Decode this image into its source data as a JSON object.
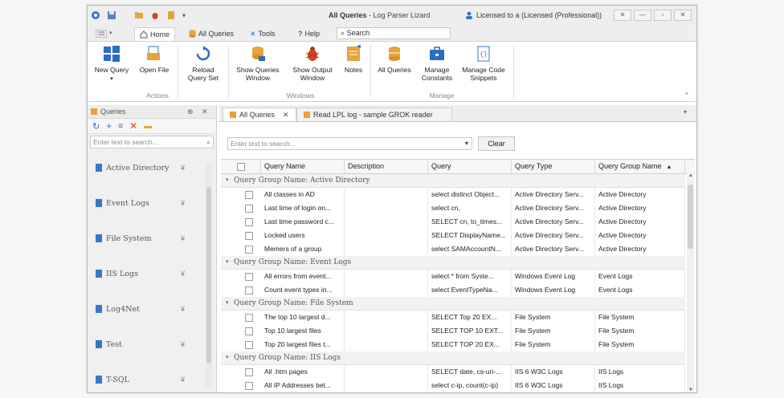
{
  "window": {
    "title_bold": "All Queries",
    "title_rest": " - Log Parser Lizard",
    "license": "Licensed to a (Licensed (Professional))"
  },
  "ribbon_tabs": {
    "home": "Home",
    "all_queries": "All Queries",
    "tools": "Tools",
    "help": "Help",
    "search": "Search"
  },
  "ribbon": {
    "new_query": "New Query",
    "open_file": "Open File",
    "reload": "Reload",
    "query_set": "Query Set",
    "show_queries": "Show Queries",
    "show_output": "Show Output",
    "window_word": "Window",
    "notes": "Notes",
    "all_queries": "All Queries",
    "manage": "Manage",
    "constants": "Constants",
    "manage_code": "Manage Code",
    "snippets": "Snippets",
    "group_actions": "Actions",
    "group_windows": "Windows",
    "group_manage": "Manage"
  },
  "left_panel": {
    "title": "Queries",
    "search_placeholder": "Enter text to search...",
    "groups": [
      "Active Directory",
      "Event Logs",
      "File System",
      "IIS Logs",
      "Log4Net",
      "Test",
      "T-SQL"
    ]
  },
  "doc_tabs": {
    "tab1": "All Queries",
    "tab2": "Read LPL log - sample GROK reader"
  },
  "filter": {
    "placeholder": "Enter text to search...",
    "clear": "Clear"
  },
  "grid": {
    "columns": [
      "Query Name",
      "Description",
      "Query",
      "Query Type",
      "Query Group Name"
    ],
    "group_prefix": "Query Group Name: ",
    "groups": [
      {
        "name": "Active Directory",
        "rows": [
          [
            "All classes in AD",
            "",
            "select distinct Object...",
            "Active Directory Serv...",
            "Active Directory"
          ],
          [
            "Last time of login on...",
            "",
            "select cn,",
            "Active Directory Serv...",
            "Active Directory"
          ],
          [
            "Last time password c...",
            "",
            "SELECT cn, to_times...",
            "Active Directory Serv...",
            "Active Directory"
          ],
          [
            "Locked users",
            "",
            "SELECT DisplayName...",
            "Active Directory Serv...",
            "Active Directory"
          ],
          [
            "Memers of a group",
            "",
            "select SAMAccountN...",
            "Active Directory Serv...",
            "Active Directory"
          ]
        ]
      },
      {
        "name": "Event Logs",
        "rows": [
          [
            "All errors from event...",
            "",
            "select * from Syste...",
            "Windows Event Log",
            "Event Logs"
          ],
          [
            "Count event types in...",
            "",
            "select EventTypeNa...",
            "Windows Event Log",
            "Event Logs"
          ]
        ]
      },
      {
        "name": "File System",
        "rows": [
          [
            "The top 10 largest d...",
            "",
            "SELECT Top 20   EX...",
            "File System",
            "File System"
          ],
          [
            "Top 10 largest files",
            "",
            "SELECT TOP 10 EXT...",
            "File System",
            "File System"
          ],
          [
            "Top 20 largest files t...",
            "",
            "SELECT TOP 20   EX...",
            "File System",
            "File System"
          ]
        ]
      },
      {
        "name": "IIS Logs",
        "rows": [
          [
            "All .htm pages",
            "",
            "SELECT date, cs-uri-...",
            "IIS 6 W3C Logs",
            "IIS Logs"
          ],
          [
            "All IP Addresses bet...",
            "",
            "select c-ip, count(c-ip)",
            "IIS 6 W3C Logs",
            "IIS Logs"
          ]
        ]
      }
    ]
  },
  "colors": {
    "accent_blue": "#2b6cc4",
    "orange": "#e8a33a",
    "red": "#d04420"
  }
}
